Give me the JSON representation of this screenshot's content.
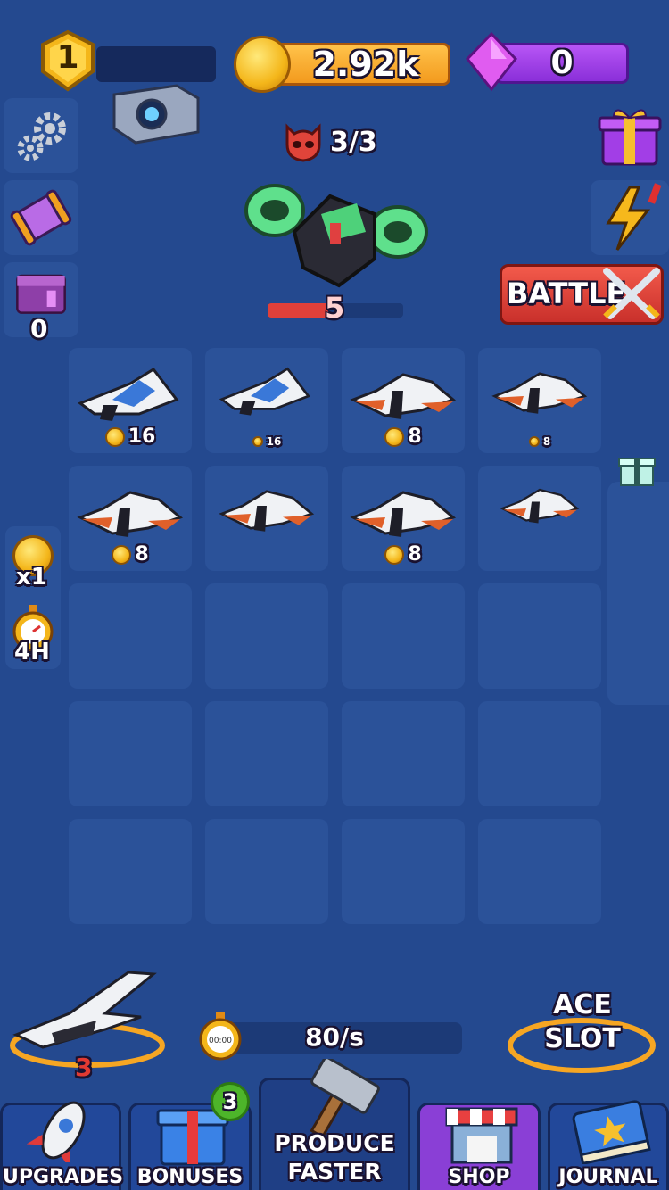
{
  "top": {
    "level": "1",
    "coins": "2.92k",
    "gems": "0"
  },
  "enemy": {
    "kills": "3/3",
    "level": "5",
    "health_fraction": 0.45
  },
  "left": {
    "chest_count": "0",
    "coin_multiplier": "x1",
    "timer": "4H"
  },
  "battle_label": "BATTLE",
  "grid": {
    "rows": [
      [
        {
          "type": "blue",
          "price": "16",
          "big": true
        },
        {
          "type": "blue",
          "price": "16",
          "big": false
        },
        {
          "type": "orange",
          "price": "8",
          "big": true
        },
        {
          "type": "orange",
          "price": "8",
          "big": false
        }
      ],
      [
        {
          "type": "orange",
          "price": "8",
          "big": true
        },
        {
          "type": "orange",
          "price": "",
          "big": false
        },
        {
          "type": "orange",
          "price": "8",
          "big": true
        },
        {
          "type": "orange-small",
          "price": "",
          "big": false
        }
      ],
      [
        null,
        null,
        null,
        null
      ],
      [
        null,
        null,
        null,
        null
      ],
      [
        null,
        null,
        null,
        null
      ]
    ]
  },
  "bottom": {
    "ace_level": "3",
    "production_rate": "80/s",
    "stopwatch_text": "00:00",
    "ace_slot_line1": "ACE",
    "ace_slot_line2": "SLOT"
  },
  "nav": {
    "upgrades": "UPGRADES",
    "bonuses": "BONUSES",
    "bonuses_badge": "3",
    "produce_line1": "PRODUCE",
    "produce_line2": "FASTER",
    "shop": "SHOP",
    "journal": "JOURNAL"
  },
  "colors": {
    "background": "#24498f",
    "cell": "#2b5299",
    "coin": "#f4b61a",
    "gem": "#9d3fe6",
    "battle": "#d9382f"
  }
}
